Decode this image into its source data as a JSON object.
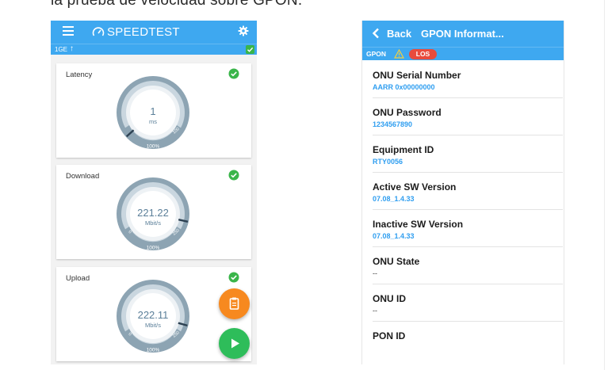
{
  "caption": "la prueba de velocidad sobre GPON.",
  "colors": {
    "accent": "#3ea8f0",
    "success": "#3ab54a",
    "error": "#e94b3c",
    "fab_orange": "#f7891f",
    "fab_green": "#2ebd5a",
    "value_blue": "#2f9ef0"
  },
  "speedtest": {
    "title": "SPEEDTEST",
    "menu_icon": "hamburger-menu-icon",
    "settings_icon": "gear-icon",
    "status": {
      "interface": "1GE",
      "direction_icon": "arrow-up-icon",
      "ok_icon": "check-badge-icon"
    },
    "cards": [
      {
        "label": "Latency",
        "value": "1",
        "unit": "ms",
        "scale_min": "",
        "scale_max": "100",
        "percent": "100%",
        "needle_fraction": 0.01
      },
      {
        "label": "Download",
        "value": "221.22",
        "unit": "Mbit/s",
        "scale_min": "0",
        "scale_max": "250",
        "percent": "100%",
        "needle_fraction": 0.88
      },
      {
        "label": "Upload",
        "value": "222.11",
        "unit": "Mbit/s",
        "scale_min": "0",
        "scale_max": "250",
        "percent": "100%",
        "needle_fraction": 0.89
      }
    ],
    "fabs": {
      "clipboard_icon": "clipboard-icon",
      "play_icon": "play-icon"
    }
  },
  "gpon": {
    "back_label": "Back",
    "title": "GPON Informat...",
    "status": {
      "label": "GPON",
      "warning_icon": "warning-triangle-icon",
      "alarm": "LOS"
    },
    "rows": [
      {
        "key": "ONU Serial Number",
        "value": "AARR 0x00000000"
      },
      {
        "key": "ONU Password",
        "value": "1234567890"
      },
      {
        "key": "Equipment ID",
        "value": "RTY0056"
      },
      {
        "key": "Active SW Version",
        "value": "07.08_1.4.33"
      },
      {
        "key": "Inactive SW Version",
        "value": "07.08_1.4.33"
      },
      {
        "key": "ONU State",
        "value": "--"
      },
      {
        "key": "ONU ID",
        "value": "--"
      },
      {
        "key": "PON ID",
        "value": ""
      }
    ]
  }
}
